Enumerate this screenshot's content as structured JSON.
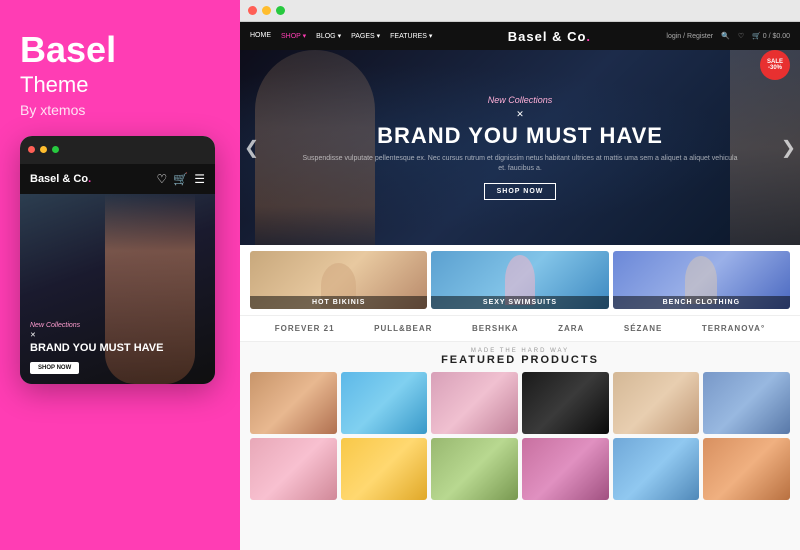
{
  "left": {
    "title": "Basel",
    "subtitle": "Theme",
    "by": "By xtemos",
    "mobile": {
      "logo_text": "Basel & Co.",
      "logo_dot_color": "#ff3db4",
      "hero_new": "New Collections",
      "hero_title": "BRAND YOU MUST HAVE",
      "hero_btn": "SHOP NOW"
    }
  },
  "desktop": {
    "nav": {
      "links": [
        "HOME",
        "SHOP",
        "BLOG",
        "PAGES",
        "FEATURES"
      ],
      "active": "SHOP",
      "logo": "Basel & Co.",
      "login": "login / Register",
      "cart": "0 / $0.00"
    },
    "hero": {
      "new_collections": "New Collections",
      "title": "BRAND YOU MUST HAVE",
      "subtitle": "Suspendisse vulputate pellentesque ex. Nec cursus rutrum et dignissim netus habitant ultrices at mattis uma sem a aliquet a aliquet vehicula et. faucibus a.",
      "btn": "SHOP NOW",
      "sale_badge": "SALE -30%",
      "left_arrow": "❮",
      "right_arrow": "❯"
    },
    "categories": [
      {
        "label": "HOT BIKINIS",
        "bg_class": "cat-bg-1"
      },
      {
        "label": "SEXY SWIMSUITS",
        "bg_class": "cat-bg-2"
      },
      {
        "label": "BENCH CLOTHING",
        "bg_class": "cat-bg-3"
      }
    ],
    "brands": [
      "FOREVER 21",
      "PULL&BEAR",
      "Bershka",
      "ZARA",
      "SÉZANE",
      "terranova°"
    ],
    "featured": {
      "made": "MADE THE HARD WAY",
      "title": "FEATURED PRODUCTS"
    },
    "products_row1": [
      {
        "class": "prod-1"
      },
      {
        "class": "prod-2"
      },
      {
        "class": "prod-3"
      },
      {
        "class": "prod-4"
      },
      {
        "class": "prod-5"
      },
      {
        "class": "prod-6"
      }
    ],
    "products_row2": [
      {
        "class": "prod-7"
      },
      {
        "class": "prod-8"
      },
      {
        "class": "prod-9"
      },
      {
        "class": "prod-10"
      },
      {
        "class": "prod-11"
      },
      {
        "class": "prod-12"
      }
    ]
  }
}
